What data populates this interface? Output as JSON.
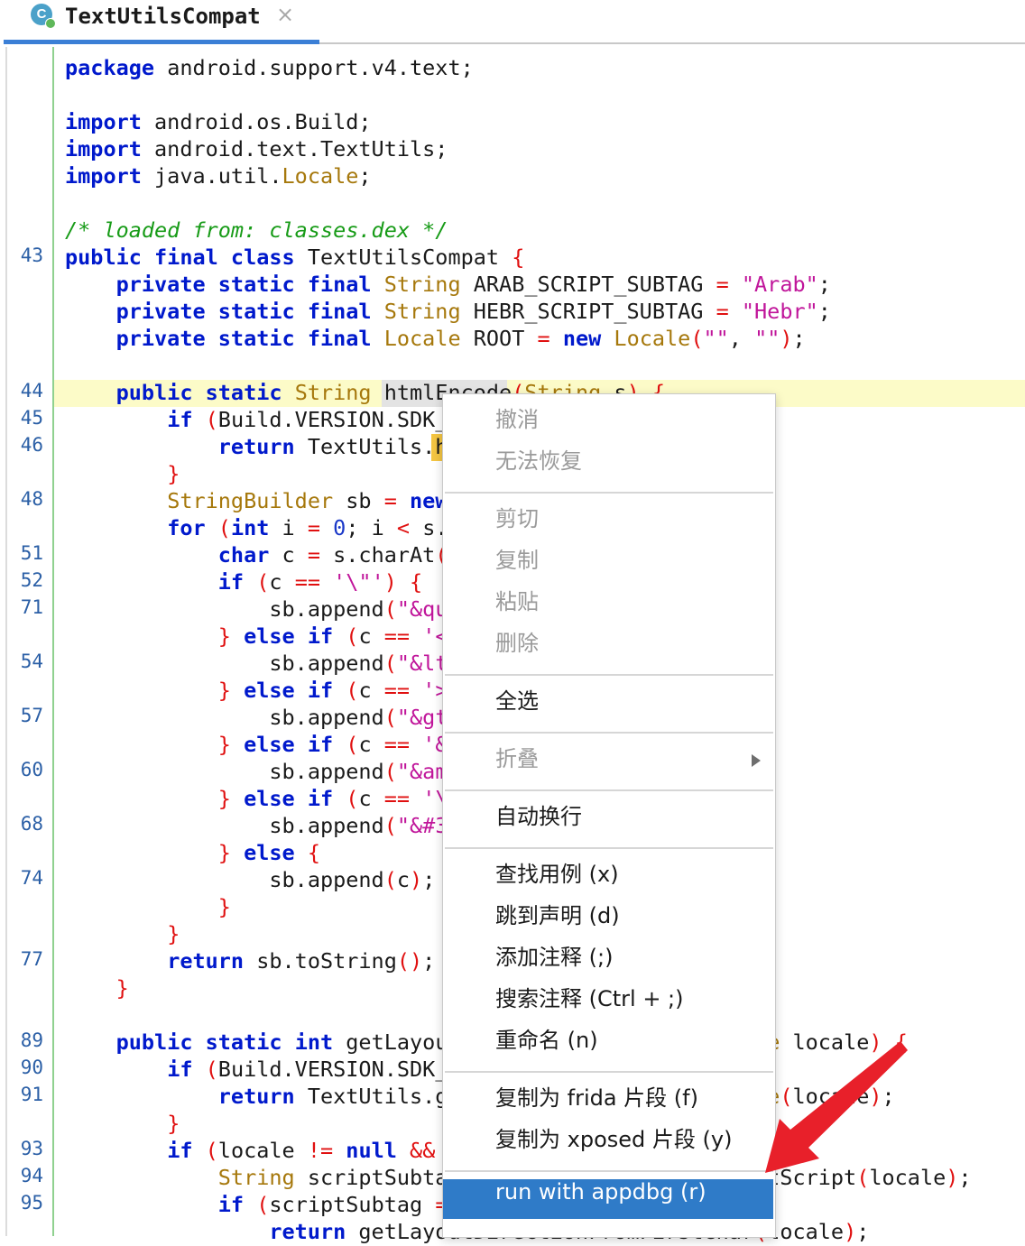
{
  "tab": {
    "icon_letter": "C",
    "title": "TextUtilsCompat",
    "close": "×"
  },
  "editor": {
    "line_numbers": [
      "",
      "",
      "",
      "",
      "",
      "",
      "",
      "43",
      "",
      "",
      "",
      "",
      "44",
      "45",
      "46",
      "",
      "48",
      "",
      "51",
      "52",
      "71",
      "",
      "54",
      "",
      "57",
      "",
      "60",
      "",
      "68",
      "",
      "74",
      "",
      "",
      "77",
      "",
      "",
      "89",
      "90",
      "91",
      "",
      "93",
      "94",
      "95",
      ""
    ],
    "code_lines": [
      [
        [
          "kw",
          "package"
        ],
        [
          "sc",
          " android.support.v4.text;"
        ]
      ],
      [],
      [
        [
          "kw",
          "import"
        ],
        [
          "sc",
          " android.os.Build;"
        ]
      ],
      [
        [
          "kw",
          "import"
        ],
        [
          "sc",
          " android.text.TextUtils;"
        ]
      ],
      [
        [
          "kw",
          "import"
        ],
        [
          "sc",
          " java.util."
        ],
        [
          "ty",
          "Locale"
        ],
        [
          "sc",
          ";"
        ]
      ],
      [],
      [
        [
          "cm",
          "/* loaded from: classes.dex */"
        ]
      ],
      [
        [
          "kw",
          "public final class"
        ],
        [
          "sc",
          " TextUtilsCompat "
        ],
        [
          "pr",
          "{"
        ]
      ],
      [
        [
          "sc",
          "    "
        ],
        [
          "kw",
          "private static final"
        ],
        [
          "sc",
          " "
        ],
        [
          "ty",
          "String"
        ],
        [
          "sc",
          " ARAB_SCRIPT_SUBTAG "
        ],
        [
          "pr",
          "="
        ],
        [
          "sc",
          " "
        ],
        [
          "str",
          "\"Arab\""
        ],
        [
          "sc",
          ";"
        ]
      ],
      [
        [
          "sc",
          "    "
        ],
        [
          "kw",
          "private static final"
        ],
        [
          "sc",
          " "
        ],
        [
          "ty",
          "String"
        ],
        [
          "sc",
          " HEBR_SCRIPT_SUBTAG "
        ],
        [
          "pr",
          "="
        ],
        [
          "sc",
          " "
        ],
        [
          "str",
          "\"Hebr\""
        ],
        [
          "sc",
          ";"
        ]
      ],
      [
        [
          "sc",
          "    "
        ],
        [
          "kw",
          "private static final"
        ],
        [
          "sc",
          " "
        ],
        [
          "ty",
          "Locale"
        ],
        [
          "sc",
          " ROOT "
        ],
        [
          "pr",
          "="
        ],
        [
          "sc",
          " "
        ],
        [
          "kw",
          "new"
        ],
        [
          "sc",
          " "
        ],
        [
          "ty",
          "Locale"
        ],
        [
          "pr",
          "("
        ],
        [
          "str",
          "\"\""
        ],
        [
          "sc",
          ", "
        ],
        [
          "str",
          "\"\""
        ],
        [
          "pr",
          ")"
        ],
        [
          "sc",
          ";"
        ]
      ],
      [],
      [
        [
          "sc",
          "    "
        ],
        [
          "kw",
          "public static"
        ],
        [
          "sc",
          " "
        ],
        [
          "ty",
          "String"
        ],
        [
          "sc",
          " htmlEncode"
        ],
        [
          "pr",
          "("
        ],
        [
          "ty",
          "String"
        ],
        [
          "sc",
          " s"
        ],
        [
          "pr",
          ")"
        ],
        [
          "sc",
          " "
        ],
        [
          "pr",
          "{"
        ]
      ],
      [
        [
          "sc",
          "        "
        ],
        [
          "kw",
          "if"
        ],
        [
          "sc",
          " "
        ],
        [
          "pr",
          "("
        ],
        [
          "sc",
          "Build.VERSION.SDK_"
        ]
      ],
      [
        [
          "sc",
          "            "
        ],
        [
          "kw",
          "return"
        ],
        [
          "sc",
          " TextUtils.h"
        ]
      ],
      [
        [
          "sc",
          "        "
        ],
        [
          "pr",
          "}"
        ]
      ],
      [
        [
          "sc",
          "        "
        ],
        [
          "ty",
          "StringBuilder"
        ],
        [
          "sc",
          " sb "
        ],
        [
          "pr",
          "="
        ],
        [
          "sc",
          " "
        ],
        [
          "kw",
          "new"
        ]
      ],
      [
        [
          "sc",
          "        "
        ],
        [
          "kw",
          "for"
        ],
        [
          "sc",
          " "
        ],
        [
          "pr",
          "("
        ],
        [
          "kw",
          "int"
        ],
        [
          "sc",
          " i "
        ],
        [
          "pr",
          "="
        ],
        [
          "sc",
          " "
        ],
        [
          "num",
          "0"
        ],
        [
          "sc",
          "; i "
        ],
        [
          "pr",
          "<"
        ],
        [
          "sc",
          " s."
        ]
      ],
      [
        [
          "sc",
          "            "
        ],
        [
          "kw",
          "char"
        ],
        [
          "sc",
          " c "
        ],
        [
          "pr",
          "="
        ],
        [
          "sc",
          " s.charAt"
        ],
        [
          "pr",
          "("
        ]
      ],
      [
        [
          "sc",
          "            "
        ],
        [
          "kw",
          "if"
        ],
        [
          "sc",
          " "
        ],
        [
          "pr",
          "("
        ],
        [
          "sc",
          "c "
        ],
        [
          "pr",
          "=="
        ],
        [
          "sc",
          " "
        ],
        [
          "str",
          "'\\\"'"
        ],
        [
          "pr",
          ")"
        ],
        [
          "sc",
          " "
        ],
        [
          "pr",
          "{"
        ]
      ],
      [
        [
          "sc",
          "                sb.append"
        ],
        [
          "pr",
          "("
        ],
        [
          "str",
          "\"&qu"
        ]
      ],
      [
        [
          "sc",
          "            "
        ],
        [
          "pr",
          "}"
        ],
        [
          "sc",
          " "
        ],
        [
          "kw",
          "else if"
        ],
        [
          "sc",
          " "
        ],
        [
          "pr",
          "("
        ],
        [
          "sc",
          "c "
        ],
        [
          "pr",
          "=="
        ],
        [
          "sc",
          " "
        ],
        [
          "str",
          "'<"
        ]
      ],
      [
        [
          "sc",
          "                sb.append"
        ],
        [
          "pr",
          "("
        ],
        [
          "str",
          "\"&lt"
        ]
      ],
      [
        [
          "sc",
          "            "
        ],
        [
          "pr",
          "}"
        ],
        [
          "sc",
          " "
        ],
        [
          "kw",
          "else if"
        ],
        [
          "sc",
          " "
        ],
        [
          "pr",
          "("
        ],
        [
          "sc",
          "c "
        ],
        [
          "pr",
          "=="
        ],
        [
          "sc",
          " "
        ],
        [
          "str",
          "'>"
        ]
      ],
      [
        [
          "sc",
          "                sb.append"
        ],
        [
          "pr",
          "("
        ],
        [
          "str",
          "\"&gt"
        ]
      ],
      [
        [
          "sc",
          "            "
        ],
        [
          "pr",
          "}"
        ],
        [
          "sc",
          " "
        ],
        [
          "kw",
          "else if"
        ],
        [
          "sc",
          " "
        ],
        [
          "pr",
          "("
        ],
        [
          "sc",
          "c "
        ],
        [
          "pr",
          "=="
        ],
        [
          "sc",
          " "
        ],
        [
          "str",
          "'&"
        ]
      ],
      [
        [
          "sc",
          "                sb.append"
        ],
        [
          "pr",
          "("
        ],
        [
          "str",
          "\"&am"
        ]
      ],
      [
        [
          "sc",
          "            "
        ],
        [
          "pr",
          "}"
        ],
        [
          "sc",
          " "
        ],
        [
          "kw",
          "else if"
        ],
        [
          "sc",
          " "
        ],
        [
          "pr",
          "("
        ],
        [
          "sc",
          "c "
        ],
        [
          "pr",
          "=="
        ],
        [
          "sc",
          " "
        ],
        [
          "str",
          "'\\"
        ]
      ],
      [
        [
          "sc",
          "                sb.append"
        ],
        [
          "pr",
          "("
        ],
        [
          "str",
          "\"&#3"
        ]
      ],
      [
        [
          "sc",
          "            "
        ],
        [
          "pr",
          "}"
        ],
        [
          "sc",
          " "
        ],
        [
          "kw",
          "else"
        ],
        [
          "sc",
          " "
        ],
        [
          "pr",
          "{"
        ]
      ],
      [
        [
          "sc",
          "                sb.append"
        ],
        [
          "pr",
          "("
        ],
        [
          "sc",
          "c"
        ],
        [
          "pr",
          ")"
        ],
        [
          "sc",
          ";"
        ]
      ],
      [
        [
          "sc",
          "            "
        ],
        [
          "pr",
          "}"
        ]
      ],
      [
        [
          "sc",
          "        "
        ],
        [
          "pr",
          "}"
        ]
      ],
      [
        [
          "sc",
          "        "
        ],
        [
          "kw",
          "return"
        ],
        [
          "sc",
          " sb.toString"
        ],
        [
          "pr",
          "()"
        ],
        [
          "sc",
          ";"
        ]
      ],
      [
        [
          "sc",
          "    "
        ],
        [
          "pr",
          "}"
        ]
      ],
      [],
      [
        [
          "sc",
          "    "
        ],
        [
          "kw",
          "public static"
        ],
        [
          "sc",
          " "
        ],
        [
          "kw",
          "int"
        ],
        [
          "sc",
          " getLayou                         "
        ],
        [
          "ty",
          "e"
        ],
        [
          "sc",
          " locale"
        ],
        [
          "pr",
          ")"
        ],
        [
          "sc",
          " "
        ],
        [
          "pr",
          "{"
        ]
      ],
      [
        [
          "sc",
          "        "
        ],
        [
          "kw",
          "if"
        ],
        [
          "sc",
          " "
        ],
        [
          "pr",
          "("
        ],
        [
          "sc",
          "Build.VERSION.SDK_"
        ]
      ],
      [
        [
          "sc",
          "            "
        ],
        [
          "kw",
          "return"
        ],
        [
          "sc",
          " TextUtils.g                         "
        ],
        [
          "ty",
          "e"
        ],
        [
          "pr",
          "("
        ],
        [
          "sc",
          "locale"
        ],
        [
          "pr",
          ")"
        ],
        [
          "sc",
          ";"
        ]
      ],
      [
        [
          "sc",
          "        "
        ],
        [
          "pr",
          "}"
        ]
      ],
      [
        [
          "sc",
          "        "
        ],
        [
          "kw",
          "if"
        ],
        [
          "sc",
          " "
        ],
        [
          "pr",
          "("
        ],
        [
          "sc",
          "locale "
        ],
        [
          "pr",
          "!="
        ],
        [
          "sc",
          " "
        ],
        [
          "kw",
          "null"
        ],
        [
          "sc",
          " "
        ],
        [
          "pr",
          "&&"
        ]
      ],
      [
        [
          "sc",
          "            "
        ],
        [
          "ty",
          "String"
        ],
        [
          "sc",
          " scriptSubta                        etScript"
        ],
        [
          "pr",
          "("
        ],
        [
          "sc",
          "locale"
        ],
        [
          "pr",
          ")"
        ],
        [
          "sc",
          ";"
        ]
      ],
      [
        [
          "sc",
          "            "
        ],
        [
          "kw",
          "if"
        ],
        [
          "sc",
          " "
        ],
        [
          "pr",
          "("
        ],
        [
          "sc",
          "scriptSubtag "
        ],
        [
          "pr",
          "="
        ]
      ],
      [
        [
          "sc",
          "                "
        ],
        [
          "kw",
          "return"
        ],
        [
          "sc",
          " getLayoutDirectionFromFirstChar"
        ],
        [
          "pr",
          "("
        ],
        [
          "sc",
          "locale"
        ],
        [
          "pr",
          ")"
        ],
        [
          "sc",
          ";"
        ]
      ]
    ]
  },
  "context_menu": {
    "items": [
      {
        "label": "撤消",
        "disabled": true
      },
      {
        "label": "无法恢复",
        "disabled": true
      },
      {
        "label": "剪切",
        "disabled": true
      },
      {
        "label": "复制",
        "disabled": true
      },
      {
        "label": "粘贴",
        "disabled": true
      },
      {
        "label": "删除",
        "disabled": true
      },
      {
        "label": "全选",
        "disabled": false
      },
      {
        "label": "折叠",
        "disabled": true,
        "submenu": true
      },
      {
        "label": "自动换行",
        "disabled": false
      },
      {
        "label": "查找用例 (x)",
        "disabled": false
      },
      {
        "label": "跳到声明 (d)",
        "disabled": false
      },
      {
        "label": "添加注释 (;)",
        "disabled": false
      },
      {
        "label": "搜索注释 (Ctrl + ;)",
        "disabled": false
      },
      {
        "label": "重命名 (n)",
        "disabled": false
      },
      {
        "label": "复制为 frida 片段 (f)",
        "disabled": false
      },
      {
        "label": "复制为 xposed 片段 (y)",
        "disabled": false
      },
      {
        "label": "run with appdbg (r)",
        "disabled": false,
        "active": true
      }
    ]
  },
  "colors": {
    "keyword": "#0019cc",
    "type": "#a6780c",
    "string": "#c0159a",
    "comment": "#179b17",
    "punct": "#e01010",
    "menu_active": "#2f7bc8",
    "arrow": "#e8202a"
  }
}
